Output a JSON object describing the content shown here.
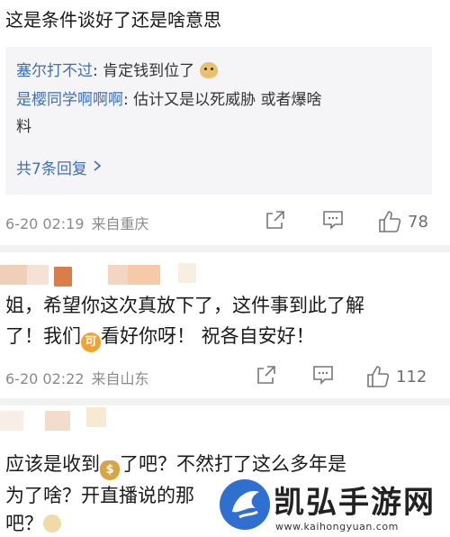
{
  "post": {
    "text": "这是条件谈好了还是啥意思"
  },
  "replies": [
    {
      "name": "塞尔打不过",
      "text": "肯定钱到位了"
    },
    {
      "name": "是樱同学啊啊啊",
      "text": "估计又是以死威胁  或者爆啥",
      "text_cont": "料"
    }
  ],
  "more_replies": "共7条回复",
  "comments": [
    {
      "time": "6-20 02:19",
      "source": "来自重庆",
      "likes": "78"
    },
    {
      "line1": "姐，希望你这次真放下了，这件事到此了解",
      "line2_a": "了！我们",
      "line2_b": "看好你呀！  祝各自安好！",
      "time": "6-20 02:22",
      "source": "来自山东",
      "likes": "112"
    },
    {
      "line1_a": "应该是收到",
      "line1_b": "了吧？不然打了这么多年是",
      "line2": "为了啥？开直播说的那",
      "line3": "吧？"
    }
  ],
  "watermark": {
    "title": "凯弘手游网",
    "url": "www.kaihongyuan.com"
  },
  "colors": {
    "link_blue": "#3f6fb6",
    "meta_gray": "#8a8a8a",
    "reply_bg": "#f5f5f7"
  }
}
